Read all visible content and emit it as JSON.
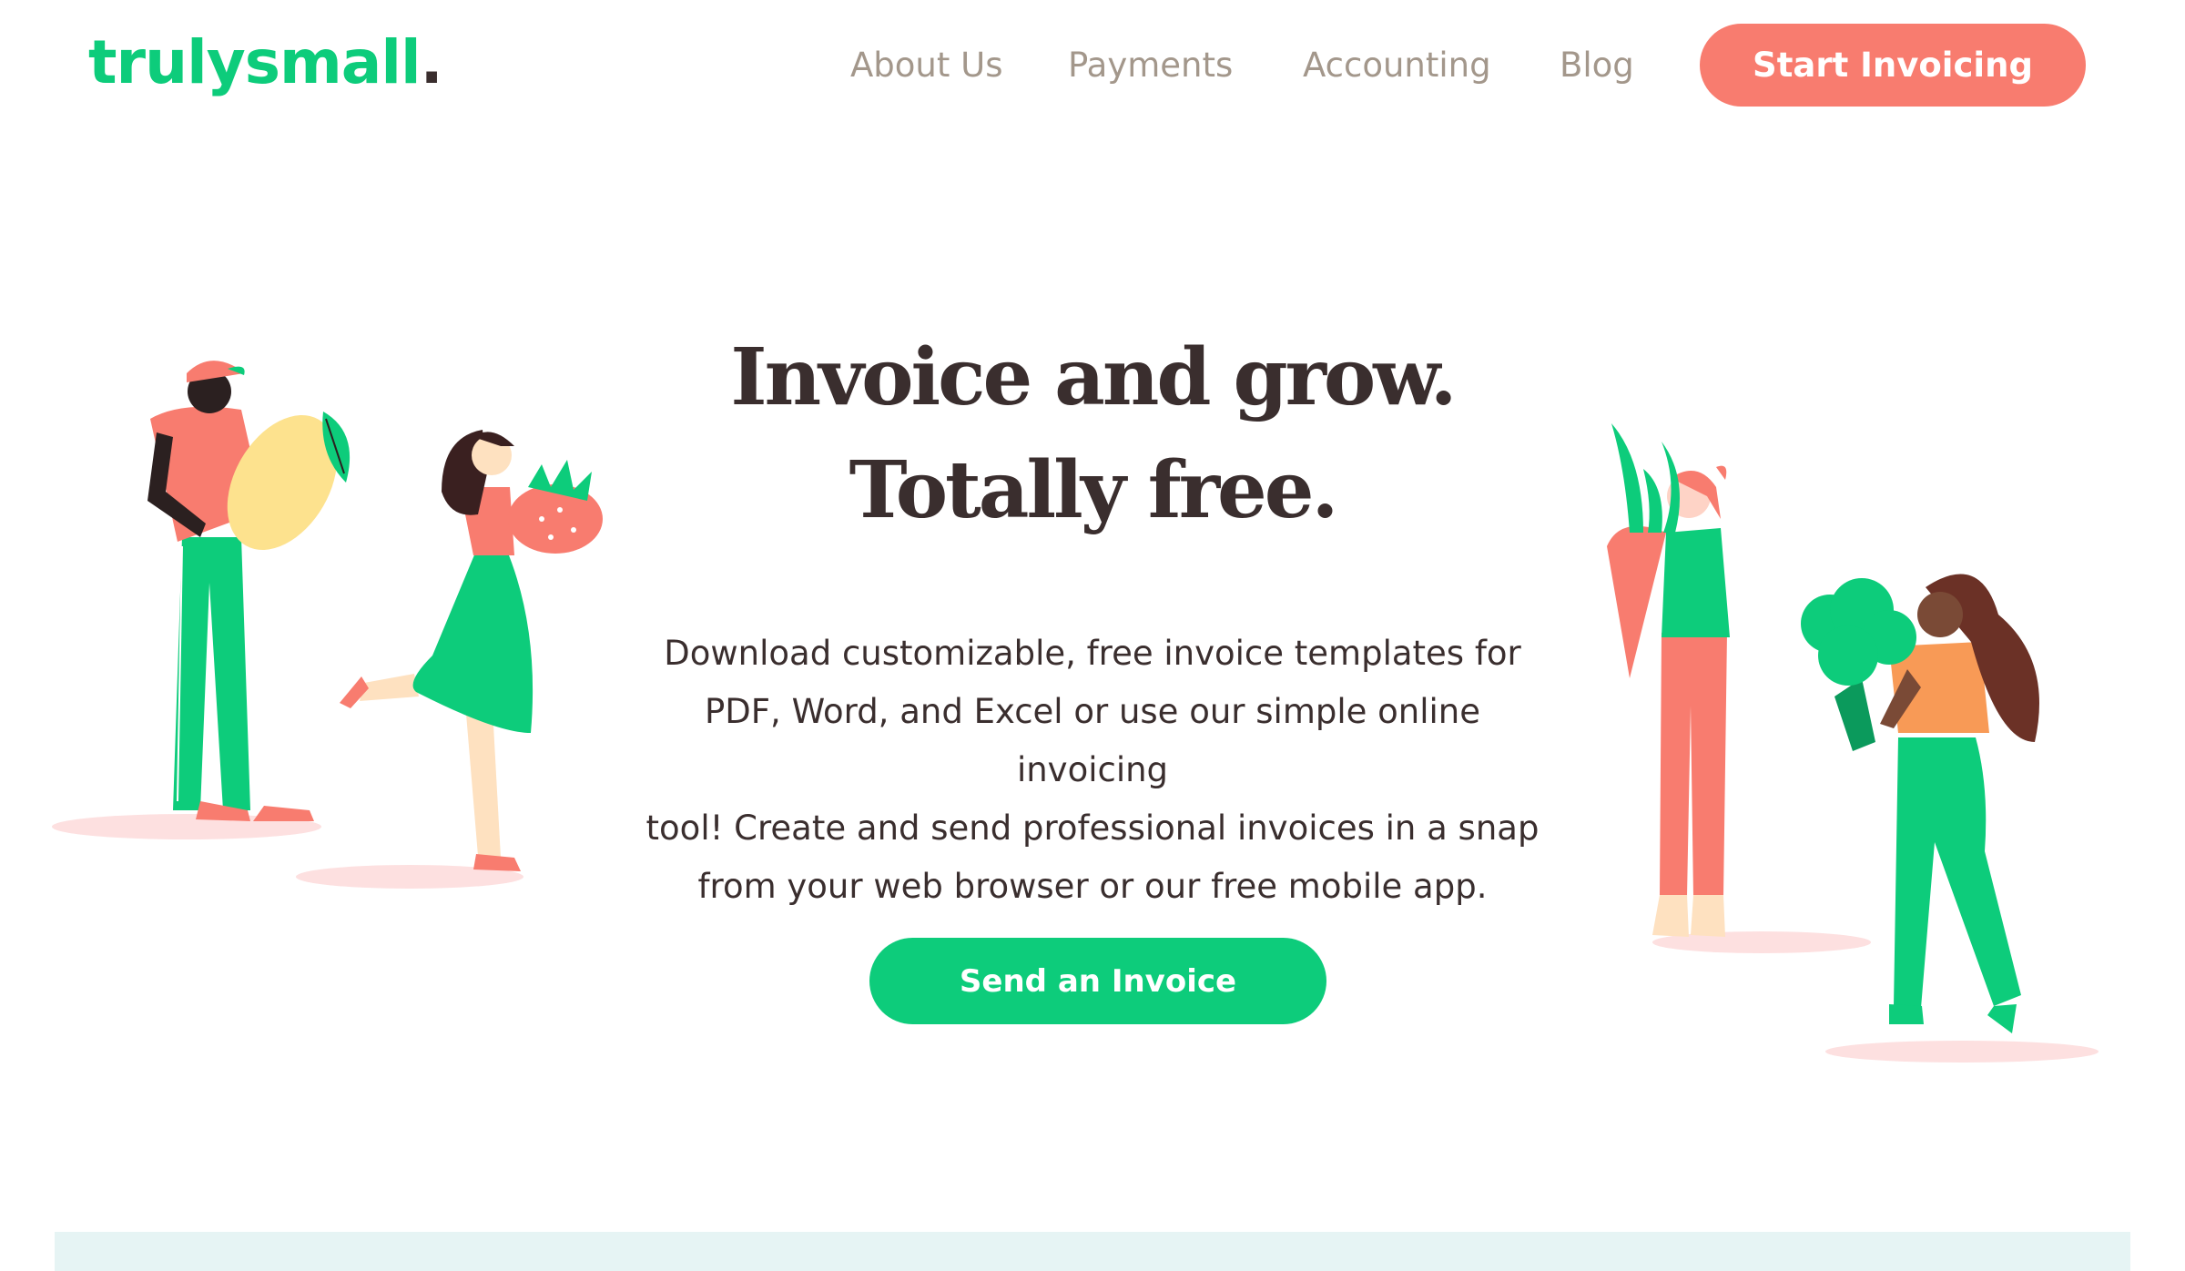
{
  "header": {
    "logo_text": "trulysmall",
    "logo_dot": ".",
    "nav": [
      "About Us",
      "Payments",
      "Accounting",
      "Blog"
    ],
    "cta_label": "Start Invoicing"
  },
  "hero": {
    "headline_line1": "Invoice and grow.",
    "headline_line2": "Totally free.",
    "description_lines": [
      "Download customizable, free invoice templates for",
      "PDF, Word, and Excel or use our simple online invoicing",
      "tool! Create and send professional invoices in a snap",
      "from your web browser or our free mobile app."
    ],
    "cta_label": "Send an Invoice"
  },
  "colors": {
    "brand_green": "#0dcc7b",
    "cta_coral": "#f87c6f",
    "text_dark": "#3a2e2e",
    "nav_text": "#a3978b",
    "band_bg": "#e6f4f4"
  },
  "icons": [
    "man-with-lemon-illustration",
    "woman-with-strawberry-illustration",
    "woman-with-carrot-illustration",
    "woman-with-broccoli-illustration"
  ]
}
